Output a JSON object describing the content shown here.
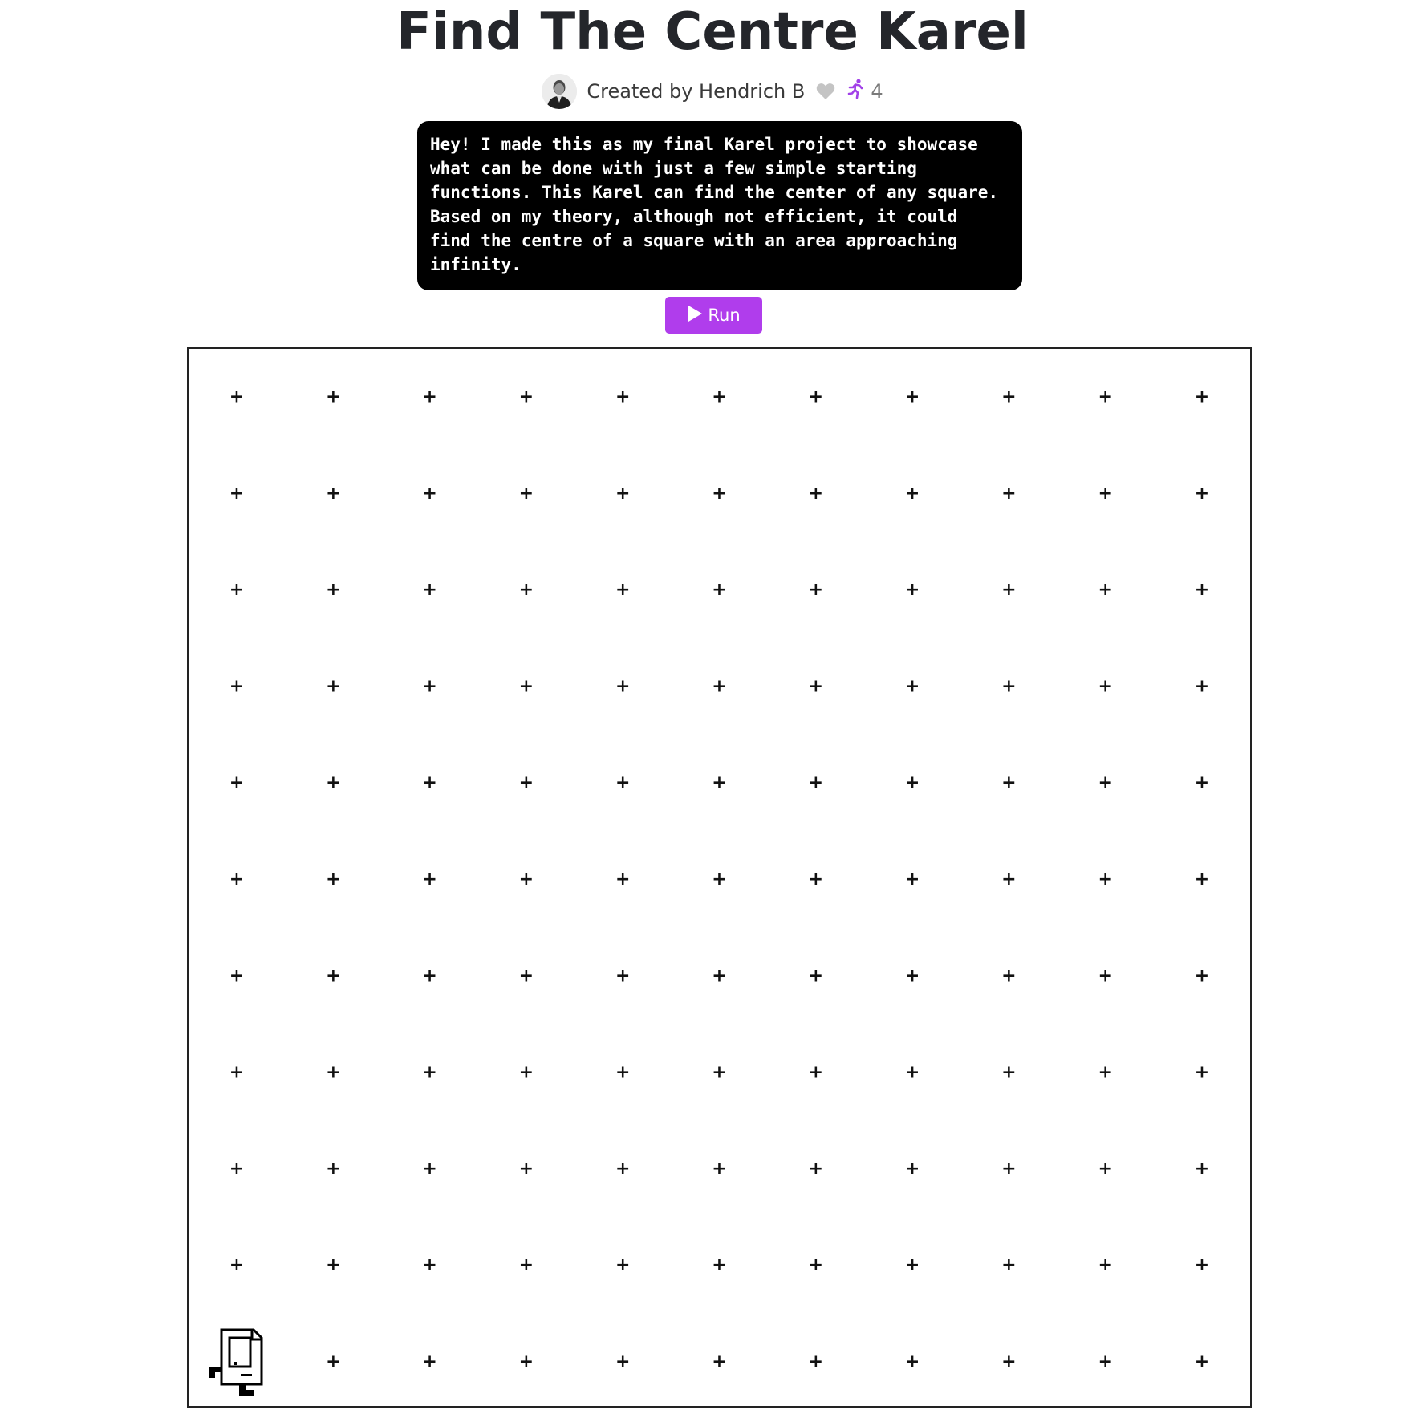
{
  "header": {
    "title": "Find The Centre Karel"
  },
  "byline": {
    "created_by": "Created by Hendrich B",
    "like_icon": "heart-icon",
    "runs_icon": "running-person-icon",
    "run_count": "4"
  },
  "description": "Hey! I made this as my final Karel project to showcase\nwhat can be done with just a few simple starting\nfunctions. This Karel can find the center of any square.\nBased on my theory, although not efficient, it could\nfind the centre of a square with an area approaching\ninfinity.",
  "run_button": {
    "label": "Run",
    "icon": "play-icon"
  },
  "world": {
    "rows": 11,
    "cols": 11,
    "corner_marker": "+",
    "karel": {
      "row": 1,
      "col": 1,
      "facing": "east"
    }
  },
  "colors": {
    "accent": "#b03dec",
    "run_icon_color": "#a140e8",
    "heart_color": "#c4c4c4",
    "description_bg": "#000000",
    "title_color": "#24262b"
  }
}
